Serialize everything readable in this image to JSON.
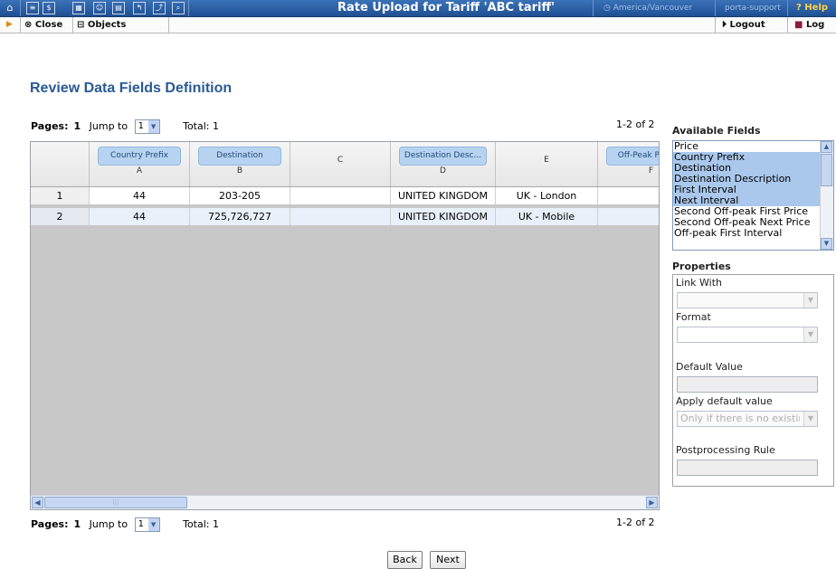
{
  "toolbar": {
    "title": "Rate Upload for Tariff 'ABC tariff'",
    "timezone": "America/Vancouver",
    "user": "porta-support",
    "help_label": "Help"
  },
  "actions": {
    "close_label": "Close",
    "objects_label": "Objects",
    "logout_label": "Logout",
    "log_label": "Log"
  },
  "page": {
    "title": "Review Data Fields Definition"
  },
  "pager_top": {
    "pages_label": "Pages:",
    "page": "1",
    "jump_label": "Jump to",
    "jump_value": "1",
    "total": "Total: 1",
    "range": "1-2 of 2"
  },
  "pager_bottom": {
    "pages_label": "Pages:",
    "page": "1",
    "jump_label": "Jump to",
    "jump_value": "1",
    "total": "Total: 1",
    "range": "1-2 of 2"
  },
  "grid": {
    "columns": [
      {
        "field": "Country Prefix",
        "letter": "A"
      },
      {
        "field": "Destination",
        "letter": "B"
      },
      {
        "field": "",
        "letter": "C"
      },
      {
        "field": "Destination Desc...",
        "letter": "D"
      },
      {
        "field": "",
        "letter": "E"
      },
      {
        "field": "Off-Peak Pe",
        "letter": "F"
      }
    ],
    "rows": [
      {
        "num": "1",
        "cells": [
          "44",
          "203-205",
          "",
          "UNITED KINGDOM",
          "UK - London",
          ""
        ]
      },
      {
        "num": "2",
        "cells": [
          "44",
          "725,726,727",
          "",
          "UNITED KINGDOM",
          "UK - Mobile",
          ""
        ]
      }
    ]
  },
  "available_fields": {
    "title": "Available Fields",
    "items": [
      {
        "label": "Price",
        "selected": false
      },
      {
        "label": "Country Prefix",
        "selected": true
      },
      {
        "label": "Destination",
        "selected": true
      },
      {
        "label": "Destination Description",
        "selected": true
      },
      {
        "label": "First Interval",
        "selected": true
      },
      {
        "label": "Next Interval",
        "selected": true
      },
      {
        "label": "Second Off-peak First Price",
        "selected": false
      },
      {
        "label": "Second Off-peak Next Price",
        "selected": false
      },
      {
        "label": "Off-peak First Interval",
        "selected": false
      }
    ]
  },
  "properties": {
    "title": "Properties",
    "link_with_label": "Link With",
    "link_with_value": "",
    "format_label": "Format",
    "format_value": "",
    "default_value_label": "Default Value",
    "apply_default_label": "Apply default value",
    "apply_default_value": "Only if there is no existin",
    "postprocessing_label": "Postprocessing Rule"
  },
  "buttons": {
    "back_label": "Back",
    "next_label": "Next"
  },
  "colors": {
    "toolbar": "#2c62a8",
    "title": "#2a5a94",
    "pill": "#b6d3f1",
    "selection": "#a9c8ec"
  }
}
